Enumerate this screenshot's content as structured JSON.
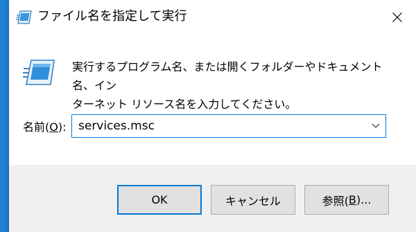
{
  "window": {
    "title": "ファイル名を指定して実行",
    "icon": "run-icon",
    "close_icon": "close-icon"
  },
  "content": {
    "description": "実行するプログラム名、または開くフォルダーやドキュメント名、イン\nターネット リソース名を入力してください。",
    "open_label_prefix": "名前(",
    "open_label_access_key": "O",
    "open_label_suffix": "):",
    "open_value": "services.msc"
  },
  "buttons": {
    "ok": "OK",
    "cancel": "キャンセル",
    "browse_prefix": "参照(",
    "browse_access_key": "B",
    "browse_suffix": ")..."
  },
  "colors": {
    "accent": "#0078d7",
    "footer_bg": "#f0f0f0",
    "button_bg": "#e1e1e1",
    "desktop": "#1e7fd4"
  }
}
